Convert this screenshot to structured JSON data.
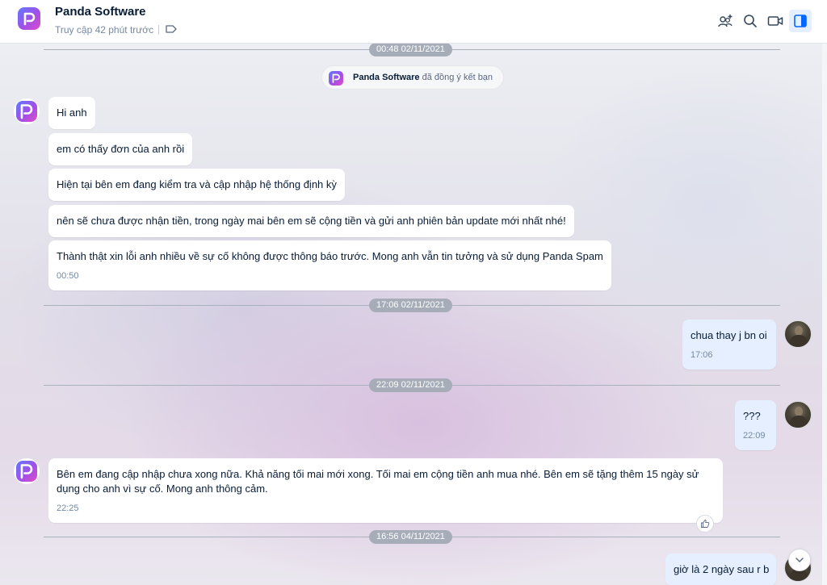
{
  "header": {
    "name": "Panda Software",
    "status": "Truy cập 42 phút trước"
  },
  "notice": {
    "name": "Panda Software",
    "text": " đã đồng ý kết bạn"
  },
  "time_separators": [
    "00:48 02/11/2021",
    "17:06 02/11/2021",
    "22:09 02/11/2021",
    "16:56 04/11/2021"
  ],
  "messages": [
    {
      "sender": "Panda Software",
      "text": "Hi anh"
    },
    {
      "sender": "Panda Software",
      "text": "em có thấy đơn của anh rồi"
    },
    {
      "sender": "Panda Software",
      "text": "Hiện tại bên em đang kiểm tra và cập nhập hệ thống định kỳ"
    },
    {
      "sender": "Panda Software",
      "text": "nên sẽ chưa được nhận tiền, trong ngày mai bên em sẽ cộng tiền và gửi anh phiên bản update mới nhất nhé!"
    },
    {
      "sender": "Panda Software",
      "text": "Thành thật xin lỗi anh nhiều về sự cố không được thông báo trước. Mong anh vẫn tin tưởng và sử dụng Panda Spam",
      "time": "00:50"
    },
    {
      "sender": "me",
      "text": "chua thay j bn oi",
      "time": "17:06"
    },
    {
      "sender": "me",
      "text": "???",
      "time": "22:09"
    },
    {
      "sender": "Panda Software",
      "text": "Bên em đang cập nhập chưa xong nữa. Khả năng tối mai mới xong. Tối mai em cộng tiền anh mua nhé. Bên em sẽ tặng thêm 15 ngày sử dụng cho anh vì sự cố. Mong anh thông cảm.",
      "time": "22:25"
    },
    {
      "sender": "me",
      "text": "giờ là 2 ngày sau r b"
    }
  ],
  "icons": {
    "header_actions": [
      "add-member-icon",
      "search-icon",
      "video-call-icon",
      "toggle-sidebar-icon"
    ],
    "status_tag": "tag-icon",
    "reaction": "thumbs-up-icon",
    "scroll": "chevron-down-icon"
  },
  "colors": {
    "accent": "#0068ff",
    "my_bubble": "#e5efff",
    "their_bubble": "#ffffff",
    "time_pill": "#a6adb9"
  }
}
